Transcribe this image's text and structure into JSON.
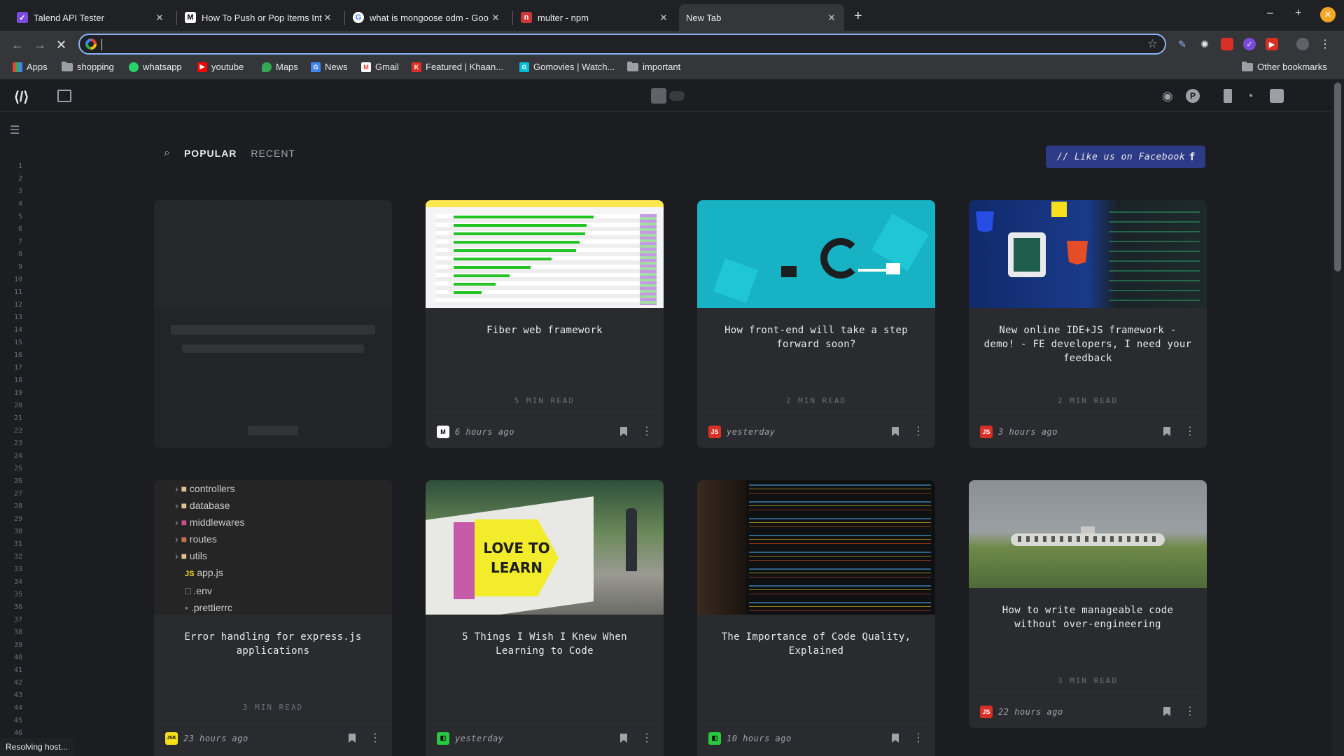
{
  "tabs": [
    {
      "title": "Talend API Tester",
      "favicon": "talend-icon",
      "color": "#7b4bdb"
    },
    {
      "title": "How To Push or Pop Items Into",
      "favicon": "medium-icon",
      "color": "#000000"
    },
    {
      "title": "what is mongoose odm - Goo",
      "favicon": "google-icon",
      "color": "#4285f4"
    },
    {
      "title": "multer - npm",
      "favicon": "npm-icon",
      "color": "#cb3837"
    },
    {
      "title": "New Tab",
      "favicon": "",
      "color": ""
    }
  ],
  "bookmarks": [
    {
      "label": "Apps",
      "icon": "apps-grid-icon"
    },
    {
      "label": "shopping",
      "icon": "folder-icon"
    },
    {
      "label": "whatsapp",
      "icon": "whatsapp-icon"
    },
    {
      "label": "youtube",
      "icon": "youtube-icon"
    },
    {
      "label": "Maps",
      "icon": "maps-icon"
    },
    {
      "label": "News",
      "icon": "news-icon"
    },
    {
      "label": "Gmail",
      "icon": "gmail-icon"
    },
    {
      "label": "Featured | Khaan...",
      "icon": "khan-icon"
    },
    {
      "label": "Gomovies | Watch...",
      "icon": "gomovies-icon"
    },
    {
      "label": "important",
      "icon": "folder-icon"
    }
  ],
  "other_bookmarks": "Other bookmarks",
  "filters": {
    "popular": "POPULAR",
    "recent": "RECENT"
  },
  "facebook_button": "// Like us on Facebook",
  "cards": [
    {
      "title": "Fiber web framework",
      "read": "5 MIN READ",
      "when": "6 hours ago",
      "source": "M"
    },
    {
      "title": "How front-end will take a step forward soon?",
      "read": "2 MIN READ",
      "when": "yesterday",
      "source": "JS"
    },
    {
      "title": "New online IDE+JS framework - demo! - FE developers, I need your feedback",
      "read": "2 MIN READ",
      "when": "3 hours ago",
      "source": "JS"
    },
    {
      "title": "Error handling for express.js applications",
      "read": "3 MIN READ",
      "when": "23 hours ago",
      "source": "JSK"
    },
    {
      "title": "5 Things I Wish I Knew When Learning to Code",
      "read": "",
      "when": "yesterday",
      "source": "H"
    },
    {
      "title": "The Importance of Code Quality, Explained",
      "read": "",
      "when": "10 hours ago",
      "source": "H"
    },
    {
      "title": "How to write manageable code without over-engineering",
      "read": "3 MIN READ",
      "when": "22 hours ago",
      "source": "JS"
    }
  ],
  "tree_items": [
    "controllers",
    "database",
    "middlewares",
    "routes",
    "utils",
    "app.js",
    ".env",
    ".prettierrc"
  ],
  "image_caption": "LOVE TO LEARN",
  "status": "Resolving host..."
}
